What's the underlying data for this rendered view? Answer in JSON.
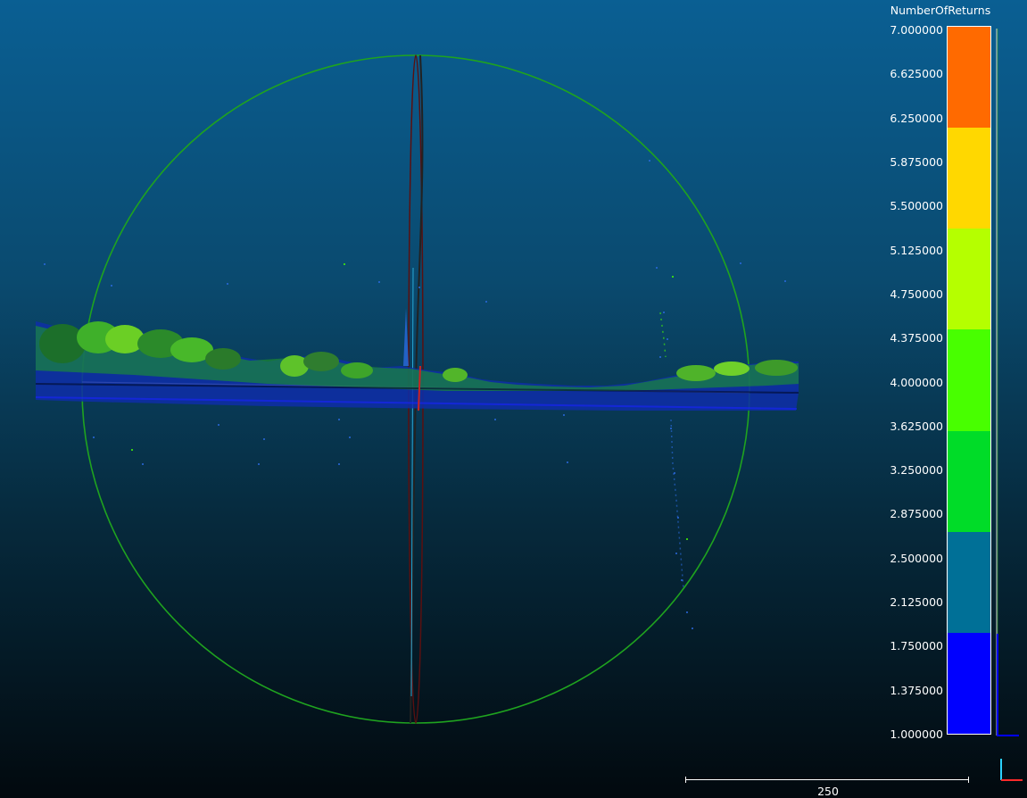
{
  "scalar_field": {
    "name": "NumberOfReturns",
    "ticks": [
      "7.000000",
      "6.625000",
      "6.250000",
      "5.875000",
      "5.500000",
      "5.125000",
      "4.750000",
      "4.375000",
      "4.000000",
      "3.625000",
      "3.250000",
      "2.875000",
      "2.500000",
      "2.125000",
      "1.750000",
      "1.375000",
      "1.000000"
    ],
    "range": [
      1,
      7
    ],
    "bands": [
      {
        "from": 6,
        "to": 7,
        "color": "#ff6a00"
      },
      {
        "from": 5,
        "to": 6,
        "color": "#ffd800"
      },
      {
        "from": 4,
        "to": 5,
        "color": "#b5ff00"
      },
      {
        "from": 3,
        "to": 4,
        "color": "#48ff00"
      },
      {
        "from": 2,
        "to": 3,
        "color": "#00dc28"
      },
      {
        "from": 1,
        "to": 2,
        "color": "#007097"
      },
      {
        "from": 0,
        "to": 1,
        "color": "#0000ff"
      }
    ]
  },
  "scale_bar": {
    "label": "250"
  },
  "colors": {
    "trackball_circle": "#1fa31f",
    "axis_x": "#ff2a2a",
    "axis_y": "#2bd1ff",
    "scale_bar": "#ffffff"
  },
  "icons": [
    "trackball-circle-icon",
    "axes-gizmo-icon",
    "scale-bar-icon"
  ]
}
